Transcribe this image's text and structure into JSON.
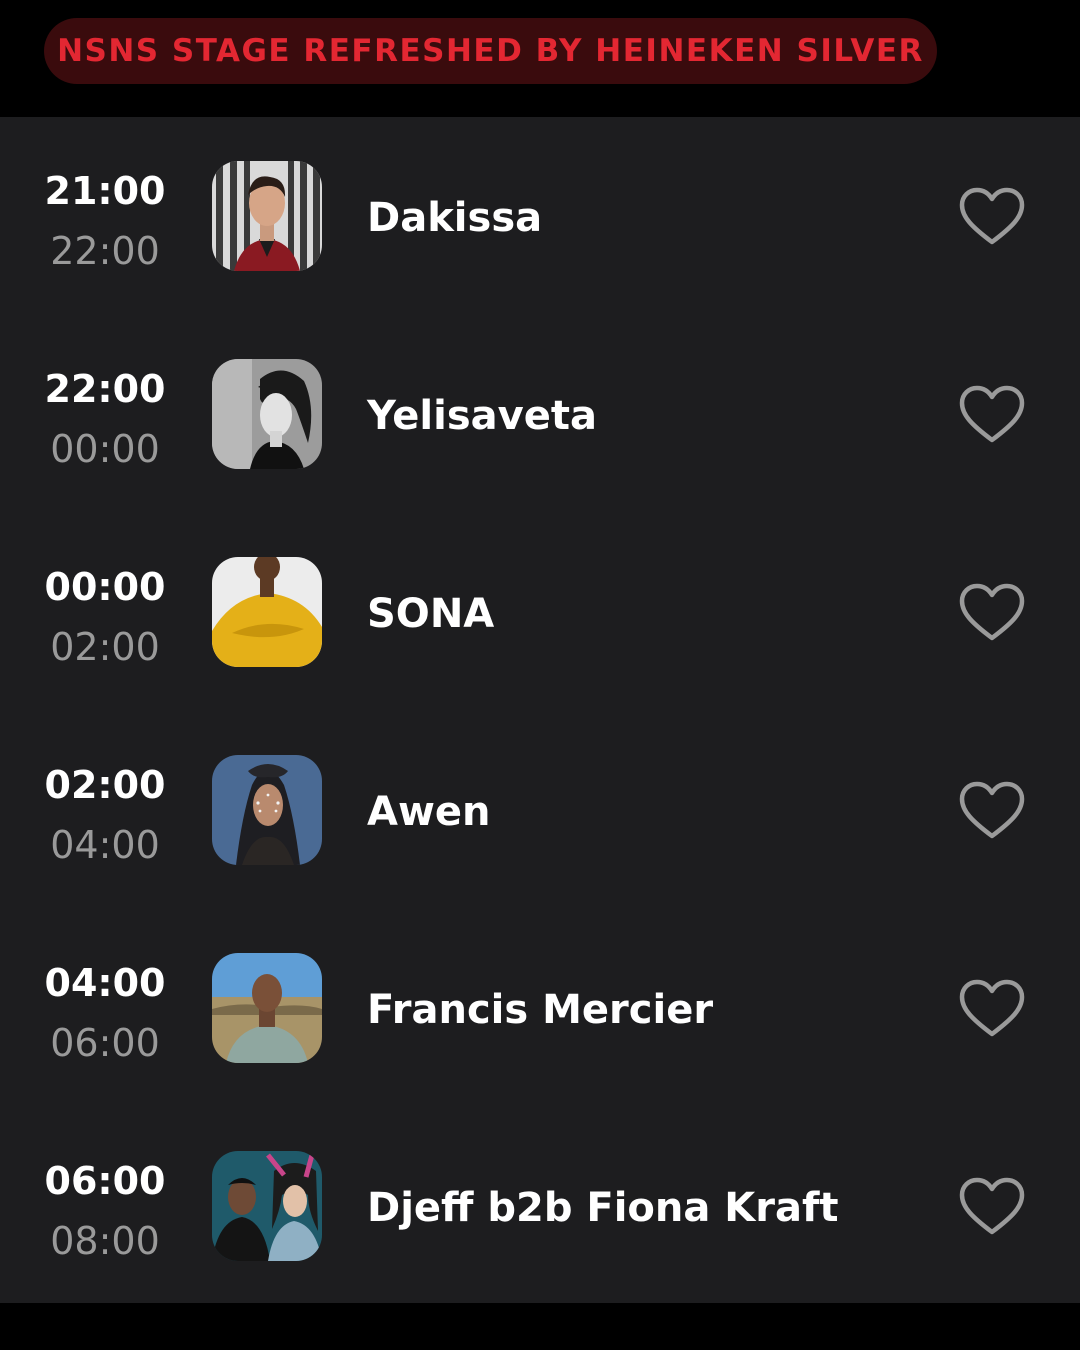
{
  "stage": {
    "title": "NSNS STAGE REFRESHED BY HEINEKEN SILVER"
  },
  "colors": {
    "accent": "#e32732",
    "pill_bg": "#3a0b0d",
    "list_bg": "#1d1d1f",
    "time_start": "#ffffff",
    "time_end": "#9a9a9a",
    "heart": "#9a9a9a"
  },
  "sets": [
    {
      "start": "21:00",
      "end": "22:00",
      "artist": "Dakissa",
      "favorite_icon": "heart-outline-icon"
    },
    {
      "start": "22:00",
      "end": "00:00",
      "artist": "Yelisaveta",
      "favorite_icon": "heart-outline-icon"
    },
    {
      "start": "00:00",
      "end": "02:00",
      "artist": "SONA",
      "favorite_icon": "heart-outline-icon"
    },
    {
      "start": "02:00",
      "end": "04:00",
      "artist": "Awen",
      "favorite_icon": "heart-outline-icon"
    },
    {
      "start": "04:00",
      "end": "06:00",
      "artist": "Francis Mercier",
      "favorite_icon": "heart-outline-icon"
    },
    {
      "start": "06:00",
      "end": "08:00",
      "artist": "Djeff b2b Fiona Kraft",
      "favorite_icon": "heart-outline-icon"
    }
  ]
}
